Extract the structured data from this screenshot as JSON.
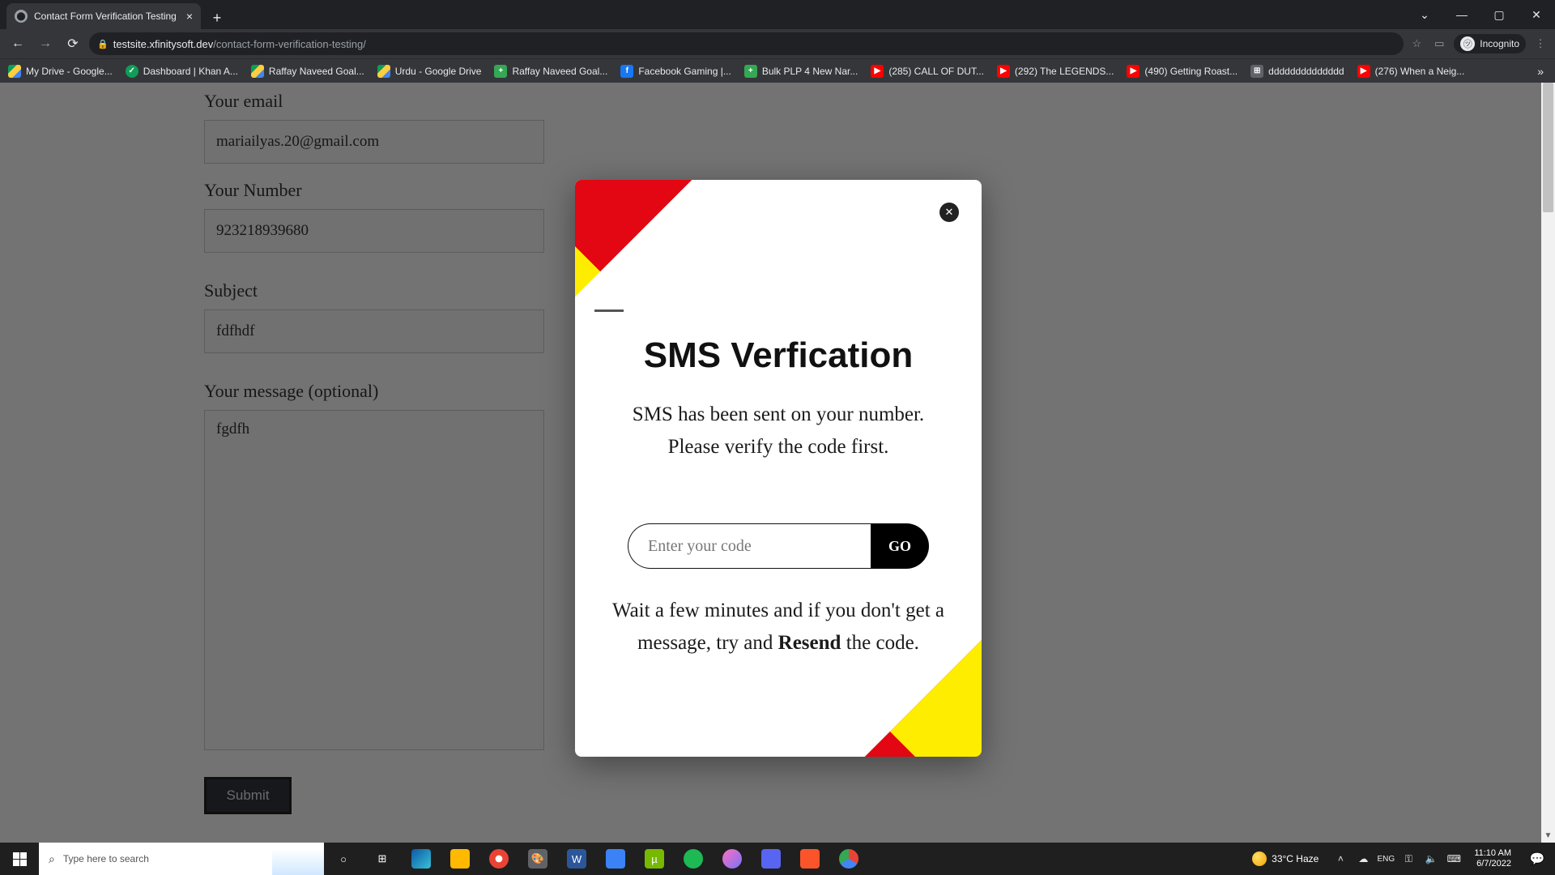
{
  "browser": {
    "tab_title": "Contact Form Verification Testing",
    "url_host": "testsite.xfinitysoft.dev",
    "url_path": "/contact-form-verification-testing/",
    "incognito_label": "Incognito",
    "bookmarks": [
      {
        "icon": "drive",
        "label": "My Drive - Google..."
      },
      {
        "icon": "green",
        "label": "Dashboard | Khan A..."
      },
      {
        "icon": "drive",
        "label": "Raffay Naveed Goal..."
      },
      {
        "icon": "drive",
        "label": "Urdu - Google Drive"
      },
      {
        "icon": "plus",
        "label": "Raffay Naveed Goal..."
      },
      {
        "icon": "fb",
        "label": "Facebook Gaming |..."
      },
      {
        "icon": "plus",
        "label": "Bulk PLP 4 New Nar..."
      },
      {
        "icon": "yt",
        "label": "(285) CALL OF DUT..."
      },
      {
        "icon": "yt",
        "label": "(292) The LEGENDS..."
      },
      {
        "icon": "yt",
        "label": "(490) Getting Roast..."
      },
      {
        "icon": "grid",
        "label": "dddddddddddddd"
      },
      {
        "icon": "yt",
        "label": "(276) When a Neig..."
      }
    ]
  },
  "form": {
    "email_label": "Your email",
    "email_value": "mariailyas.20@gmail.com",
    "number_label": "Your Number",
    "number_value": "923218939680",
    "subject_label": "Subject",
    "subject_value": "fdfhdf",
    "message_label": "Your message (optional)",
    "message_value": "fgdfh",
    "submit_label": "Submit"
  },
  "modal": {
    "title": "SMS Verfication",
    "body1": "SMS has been sent on your number. Please verify the code first.",
    "code_placeholder": "Enter your code",
    "go_label": "GO",
    "body2_pre": "Wait a few minutes and if you don't get a message, try and ",
    "body2_link": "Resend",
    "body2_post": " the code."
  },
  "taskbar": {
    "search_placeholder": "Type here to search",
    "weather": "33°C Haze",
    "time": "11:10 AM",
    "date": "6/7/2022",
    "icons": [
      {
        "name": "cortana",
        "bg": "#1f1f1f",
        "glyph": "○"
      },
      {
        "name": "taskview",
        "bg": "#1f1f1f",
        "glyph": "⊞"
      },
      {
        "name": "edge",
        "bg": "linear-gradient(135deg,#0c59a4,#39c1d7)",
        "glyph": ""
      },
      {
        "name": "explorer",
        "bg": "#ffb900",
        "glyph": ""
      },
      {
        "name": "chrome-red",
        "bg": "radial-gradient(circle,#fff 25%,#ea4335 26%)",
        "glyph": ""
      },
      {
        "name": "paint",
        "bg": "#5f6368",
        "glyph": "🎨"
      },
      {
        "name": "word",
        "bg": "#2b579a",
        "glyph": "W"
      },
      {
        "name": "todo",
        "bg": "#3b82f6",
        "glyph": ""
      },
      {
        "name": "utorrent",
        "bg": "#76b900",
        "glyph": "µ"
      },
      {
        "name": "spotify",
        "bg": "#1db954",
        "glyph": ""
      },
      {
        "name": "messenger",
        "bg": "linear-gradient(135deg,#ff6ec4,#7873f5)",
        "glyph": ""
      },
      {
        "name": "discord",
        "bg": "#5865f2",
        "glyph": ""
      },
      {
        "name": "brave",
        "bg": "#fb542b",
        "glyph": ""
      },
      {
        "name": "chrome",
        "bg": "conic-gradient(#ea4335 0 120deg,#4285f4 120deg 240deg,#34a853 240deg 360deg)",
        "glyph": ""
      }
    ]
  }
}
